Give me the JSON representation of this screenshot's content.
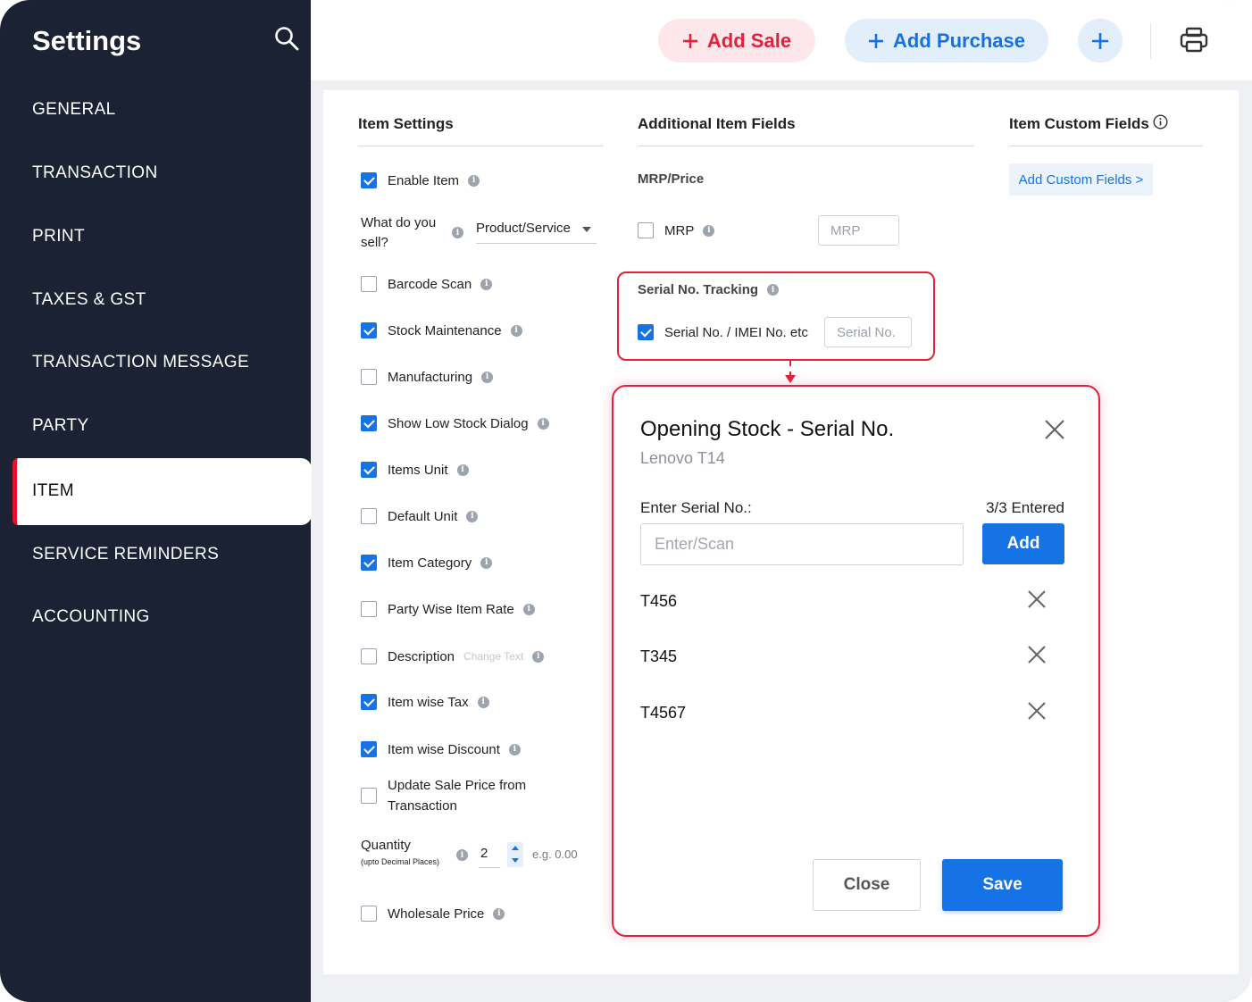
{
  "sidebar": {
    "title": "Settings",
    "items": [
      "GENERAL",
      "TRANSACTION",
      "PRINT",
      "TAXES & GST",
      "TRANSACTION MESSAGE",
      "PARTY",
      "ITEM",
      "SERVICE REMINDERS",
      "ACCOUNTING"
    ],
    "active_item": "ITEM"
  },
  "topbar": {
    "add_sale": "Add Sale",
    "add_purchase": "Add Purchase"
  },
  "item_settings": {
    "heading": "Item Settings",
    "enable_item": {
      "label": "Enable Item",
      "checked": true
    },
    "what_sell": {
      "label_line1": "What do you",
      "label_line2": "sell?",
      "value": "Product/Service"
    },
    "barcode_scan": {
      "label": "Barcode Scan",
      "checked": false
    },
    "stock_maintenance": {
      "label": "Stock Maintenance",
      "checked": true
    },
    "manufacturing": {
      "label": "Manufacturing",
      "checked": false
    },
    "show_low_stock": {
      "label": "Show Low Stock Dialog",
      "checked": true
    },
    "items_unit": {
      "label": "Items Unit",
      "checked": true
    },
    "default_unit": {
      "label": "Default Unit",
      "checked": false
    },
    "item_category": {
      "label": "Item Category",
      "checked": true
    },
    "party_wise_rate": {
      "label": "Party Wise Item Rate",
      "checked": false
    },
    "description": {
      "label": "Description",
      "change_text": "Change Text",
      "checked": false
    },
    "item_wise_tax": {
      "label": "Item wise Tax",
      "checked": true
    },
    "item_wise_discount": {
      "label": "Item wise Discount",
      "checked": true
    },
    "update_sale_price": {
      "label_line1": "Update Sale Price from",
      "label_line2": "Transaction",
      "checked": false
    },
    "quantity": {
      "label": "Quantity",
      "sublabel": "(upto Decimal Places)",
      "value": "2",
      "example": "e.g. 0.00"
    },
    "wholesale_price": {
      "label": "Wholesale Price",
      "checked": false
    }
  },
  "additional_fields": {
    "heading": "Additional Item Fields",
    "mrp_section": "MRP/Price",
    "mrp": {
      "label": "MRP",
      "checked": false,
      "placeholder": "MRP"
    },
    "serial_section": "Serial No. Tracking",
    "serial": {
      "label": "Serial No. / IMEI No. etc",
      "checked": true,
      "placeholder": "Serial No."
    }
  },
  "custom_fields": {
    "heading": "Item Custom Fields",
    "button": "Add Custom Fields >"
  },
  "dialog": {
    "title": "Opening Stock - Serial No.",
    "subtitle": "Lenovo T14",
    "label": "Enter Serial No.:",
    "count": "3/3 Entered",
    "input_placeholder": "Enter/Scan",
    "add_button": "Add",
    "serials": [
      "T456",
      "T345",
      "T4567"
    ],
    "close_button": "Close",
    "save_button": "Save"
  },
  "colors": {
    "sidebar_bg": "#1a2233",
    "accent_red": "#e3213a",
    "accent_blue": "#1673e6"
  }
}
